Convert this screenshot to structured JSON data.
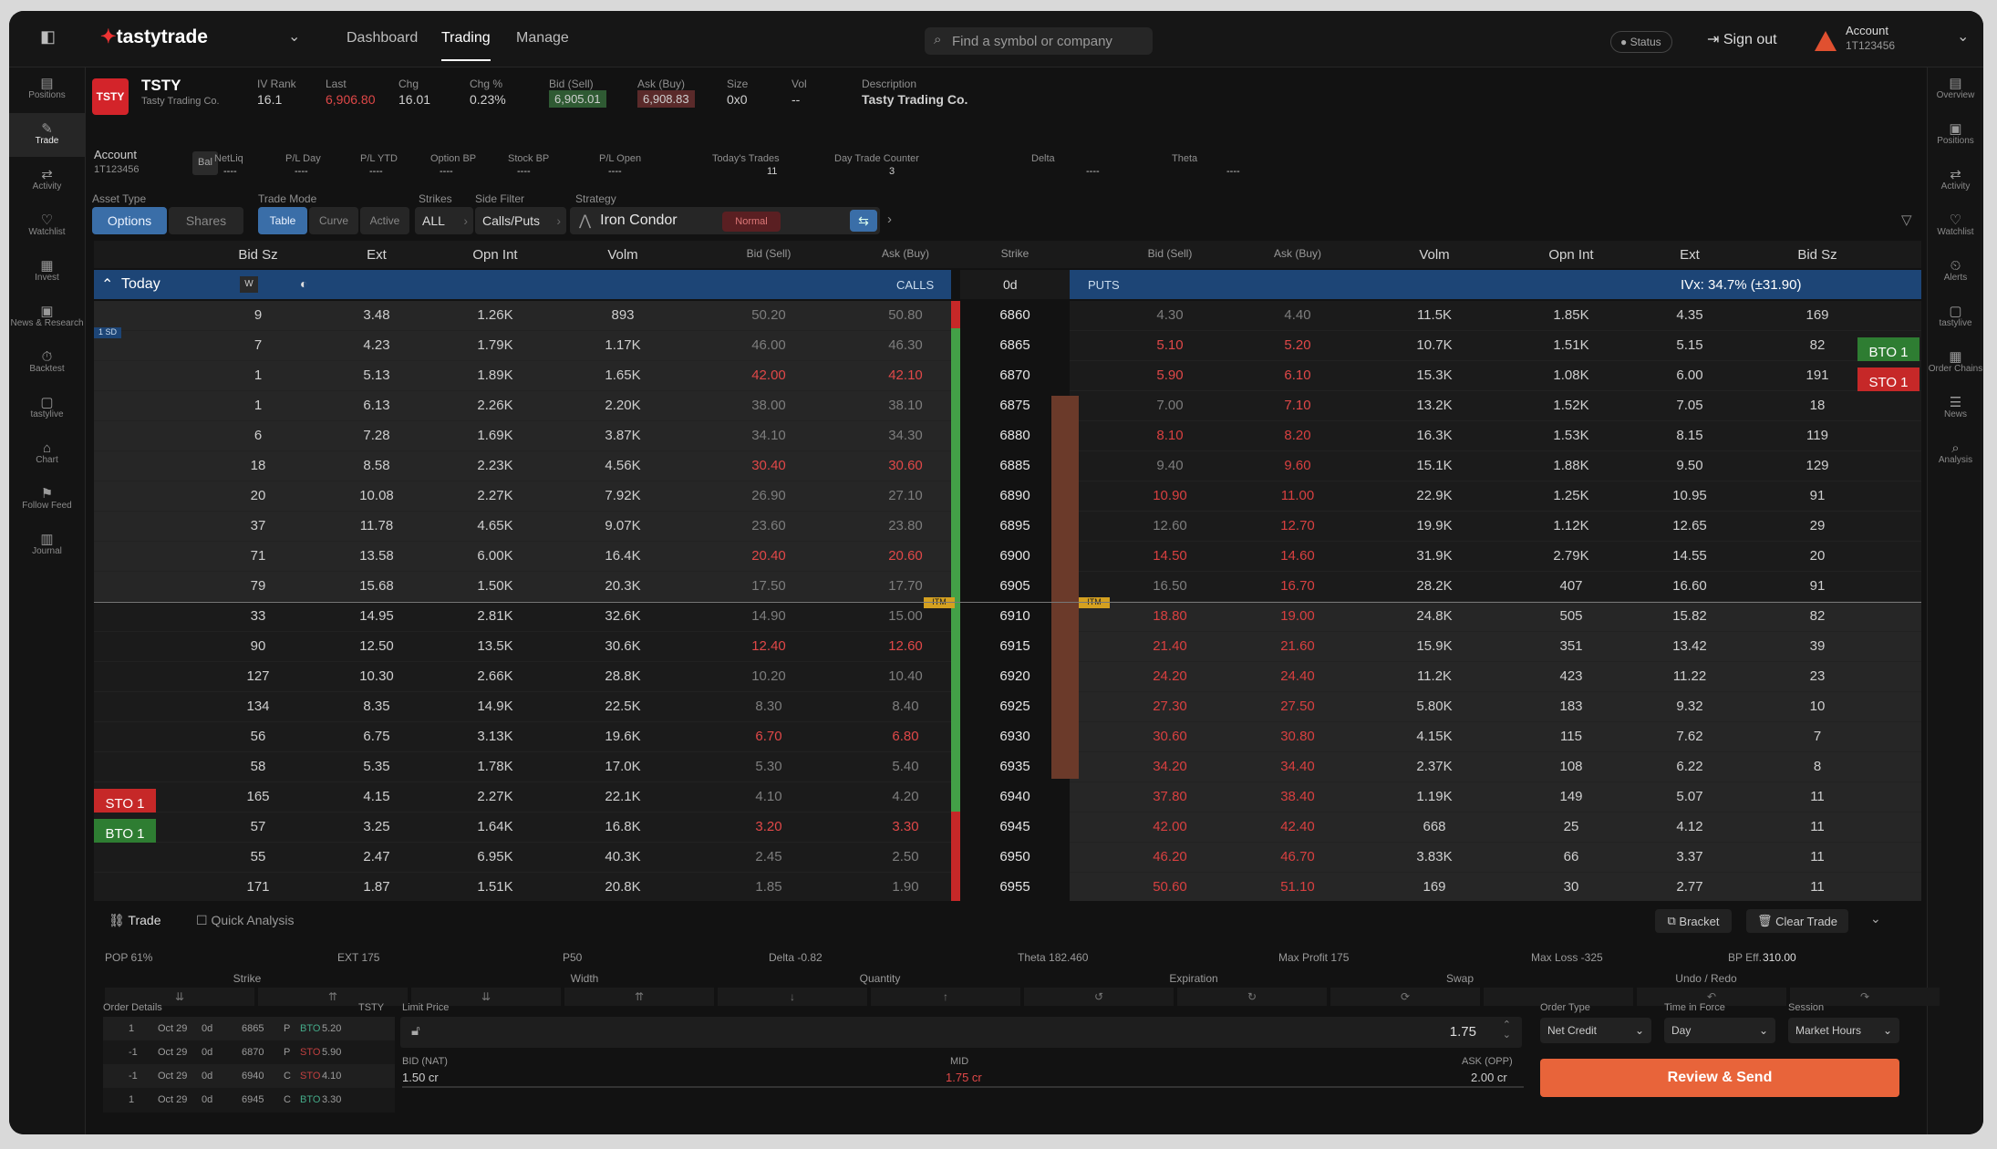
{
  "nav": {
    "brand": "tastytrade",
    "tabs": [
      "Dashboard",
      "Trading",
      "Manage"
    ],
    "search_placeholder": "Find a symbol or company",
    "status": "Status",
    "sign_out": "Sign out",
    "account_label": "Account",
    "account_id": "1T123456"
  },
  "left_sidebar": [
    "Positions",
    "Trade",
    "Activity",
    "Watchlist",
    "Invest",
    "News & Research",
    "Backtest",
    "tastylive",
    "Chart",
    "Follow Feed",
    "Journal"
  ],
  "right_sidebar": [
    "Overview",
    "Positions",
    "Activity",
    "Watchlist",
    "Alerts",
    "tastylive",
    "Order Chains",
    "News",
    "Analysis"
  ],
  "symbol": {
    "logo": "TSTY",
    "ticker": "TSTY",
    "name": "Tasty Trading Co.",
    "iv_rank_label": "IV Rank",
    "iv_rank": "16.1",
    "last_label": "Last",
    "last": "6,906.80",
    "chg_label": "Chg",
    "chg": "16.01",
    "chgpct_label": "Chg %",
    "chgpct": "0.23%",
    "bid_label": "Bid (Sell)",
    "bid": "6,905.01",
    "ask_label": "Ask (Buy)",
    "ask": "6,908.83",
    "size_label": "Size",
    "size": "0x0",
    "vol_label": "Vol",
    "vol": "--",
    "desc_label": "Description",
    "desc": "Tasty Trading Co."
  },
  "account_bar": {
    "account_label": "Account",
    "account_id": "1T123456",
    "bal": "Bal",
    "fields": [
      {
        "label": "NetLiq",
        "value": "----"
      },
      {
        "label": "P/L Day",
        "value": "----"
      },
      {
        "label": "P/L YTD",
        "value": "----"
      },
      {
        "label": "Option BP",
        "value": "----"
      },
      {
        "label": "Stock BP",
        "value": "----"
      },
      {
        "label": "P/L Open",
        "value": "----"
      },
      {
        "label": "Today's Trades",
        "value": "11"
      },
      {
        "label": "Day Trade Counter",
        "value": "3"
      },
      {
        "label": "Delta",
        "value": "----"
      },
      {
        "label": "Theta",
        "value": "----"
      }
    ]
  },
  "controls": {
    "asset_type_label": "Asset Type",
    "asset_options": "Options",
    "asset_shares": "Shares",
    "trade_mode_label": "Trade Mode",
    "mode_table": "Table",
    "mode_curve": "Curve",
    "mode_active": "Active",
    "strikes_label": "Strikes",
    "strikes": "ALL",
    "side_filter_label": "Side Filter",
    "side_filter": "Calls/Puts",
    "strategy_label": "Strategy",
    "strategy": "Iron Condor",
    "normal": "Normal"
  },
  "chain_headers": [
    "Bid Sz",
    "Ext",
    "Opn Int",
    "Volm",
    "Bid (Sell)",
    "Ask (Buy)",
    "Strike",
    "Bid (Sell)",
    "Ask (Buy)",
    "Volm",
    "Opn Int",
    "Ext",
    "Bid Sz"
  ],
  "today": {
    "label": "Today",
    "w": "W",
    "calls": "CALLS",
    "dte": "0d",
    "puts": "PUTS",
    "ivx": "IVx: 34.7% (±31.90)"
  },
  "rows": [
    [
      "9",
      "3.48",
      "1.26K",
      "893",
      "50.20",
      "50.80",
      "6860",
      "4.30",
      "4.40",
      "11.5K",
      "1.85K",
      "4.35",
      "169"
    ],
    [
      "7",
      "4.23",
      "1.79K",
      "1.17K",
      "46.00",
      "46.30",
      "6865",
      "5.10",
      "5.20",
      "10.7K",
      "1.51K",
      "5.15",
      "82"
    ],
    [
      "1",
      "5.13",
      "1.89K",
      "1.65K",
      "42.00",
      "42.10",
      "6870",
      "5.90",
      "6.10",
      "15.3K",
      "1.08K",
      "6.00",
      "191"
    ],
    [
      "1",
      "6.13",
      "2.26K",
      "2.20K",
      "38.00",
      "38.10",
      "6875",
      "7.00",
      "7.10",
      "13.2K",
      "1.52K",
      "7.05",
      "18"
    ],
    [
      "6",
      "7.28",
      "1.69K",
      "3.87K",
      "34.10",
      "34.30",
      "6880",
      "8.10",
      "8.20",
      "16.3K",
      "1.53K",
      "8.15",
      "119"
    ],
    [
      "18",
      "8.58",
      "2.23K",
      "4.56K",
      "30.40",
      "30.60",
      "6885",
      "9.40",
      "9.60",
      "15.1K",
      "1.88K",
      "9.50",
      "129"
    ],
    [
      "20",
      "10.08",
      "2.27K",
      "7.92K",
      "26.90",
      "27.10",
      "6890",
      "10.90",
      "11.00",
      "22.9K",
      "1.25K",
      "10.95",
      "91"
    ],
    [
      "37",
      "11.78",
      "4.65K",
      "9.07K",
      "23.60",
      "23.80",
      "6895",
      "12.60",
      "12.70",
      "19.9K",
      "1.12K",
      "12.65",
      "29"
    ],
    [
      "71",
      "13.58",
      "6.00K",
      "16.4K",
      "20.40",
      "20.60",
      "6900",
      "14.50",
      "14.60",
      "31.9K",
      "2.79K",
      "14.55",
      "20"
    ],
    [
      "79",
      "15.68",
      "1.50K",
      "20.3K",
      "17.50",
      "17.70",
      "6905",
      "16.50",
      "16.70",
      "28.2K",
      "407",
      "16.60",
      "91"
    ],
    [
      "33",
      "14.95",
      "2.81K",
      "32.6K",
      "14.90",
      "15.00",
      "6910",
      "18.80",
      "19.00",
      "24.8K",
      "505",
      "15.82",
      "82"
    ],
    [
      "90",
      "12.50",
      "13.5K",
      "30.6K",
      "12.40",
      "12.60",
      "6915",
      "21.40",
      "21.60",
      "15.9K",
      "351",
      "13.42",
      "39"
    ],
    [
      "127",
      "10.30",
      "2.66K",
      "28.8K",
      "10.20",
      "10.40",
      "6920",
      "24.20",
      "24.40",
      "11.2K",
      "423",
      "11.22",
      "23"
    ],
    [
      "134",
      "8.35",
      "14.9K",
      "22.5K",
      "8.30",
      "8.40",
      "6925",
      "27.30",
      "27.50",
      "5.80K",
      "183",
      "9.32",
      "10"
    ],
    [
      "56",
      "6.75",
      "3.13K",
      "19.6K",
      "6.70",
      "6.80",
      "6930",
      "30.60",
      "30.80",
      "4.15K",
      "115",
      "7.62",
      "7"
    ],
    [
      "58",
      "5.35",
      "1.78K",
      "17.0K",
      "5.30",
      "5.40",
      "6935",
      "34.20",
      "34.40",
      "2.37K",
      "108",
      "6.22",
      "8"
    ],
    [
      "165",
      "4.15",
      "2.27K",
      "22.1K",
      "4.10",
      "4.20",
      "6940",
      "37.80",
      "38.40",
      "1.19K",
      "149",
      "5.07",
      "11"
    ],
    [
      "57",
      "3.25",
      "1.64K",
      "16.8K",
      "3.20",
      "3.30",
      "6945",
      "42.00",
      "42.40",
      "668",
      "25",
      "4.12",
      "11"
    ],
    [
      "55",
      "2.47",
      "6.95K",
      "40.3K",
      "2.45",
      "2.50",
      "6950",
      "46.20",
      "46.70",
      "3.83K",
      "66",
      "3.37",
      "11"
    ],
    [
      "171",
      "1.87",
      "1.51K",
      "20.8K",
      "1.85",
      "1.90",
      "6955",
      "50.60",
      "51.10",
      "169",
      "30",
      "2.77",
      "11"
    ]
  ],
  "itm_label": "ITM",
  "strike_marker": "1 SD",
  "orders": {
    "bto": "BTO 1",
    "sto": "STO 1"
  },
  "trade_panel": {
    "tab_trade": "Trade",
    "tab_quick": "Quick Analysis",
    "bracket": "Bracket",
    "clear": "Clear Trade",
    "pop": "POP 61%",
    "ext": "EXT 175",
    "p50": "P50",
    "delta": "Delta -0.82",
    "theta": "Theta 182.460",
    "max_profit": "Max Profit 175",
    "max_loss": "Max Loss -325",
    "bp_eff_label": "BP Eff.",
    "bp_eff": "310.00",
    "groups": [
      "Strike",
      "Width",
      "Quantity",
      "Expiration",
      "Swap",
      "Undo / Redo"
    ],
    "order_details": "Order Details",
    "order_sym": "TSTY",
    "limit_price": "Limit Price",
    "price": "1.75",
    "legs": [
      [
        "1",
        "Oct 29",
        "0d",
        "6865",
        "P",
        "BTO",
        "5.20"
      ],
      [
        "-1",
        "Oct 29",
        "0d",
        "6870",
        "P",
        "STO",
        "5.90"
      ],
      [
        "-1",
        "Oct 29",
        "0d",
        "6940",
        "C",
        "STO",
        "4.10"
      ],
      [
        "1",
        "Oct 29",
        "0d",
        "6945",
        "C",
        "BTO",
        "3.30"
      ]
    ],
    "bid_nat_label": "BID (NAT)",
    "bid_nat": "1.50 cr",
    "mid_label": "MID",
    "mid": "1.75 cr",
    "ask_opp_label": "ASK (OPP)",
    "ask_opp": "2.00 cr",
    "order_type_label": "Order Type",
    "order_type": "Net Credit",
    "tif_label": "Time in Force",
    "tif": "Day",
    "session_label": "Session",
    "session": "Market Hours",
    "review": "Review & Send"
  }
}
